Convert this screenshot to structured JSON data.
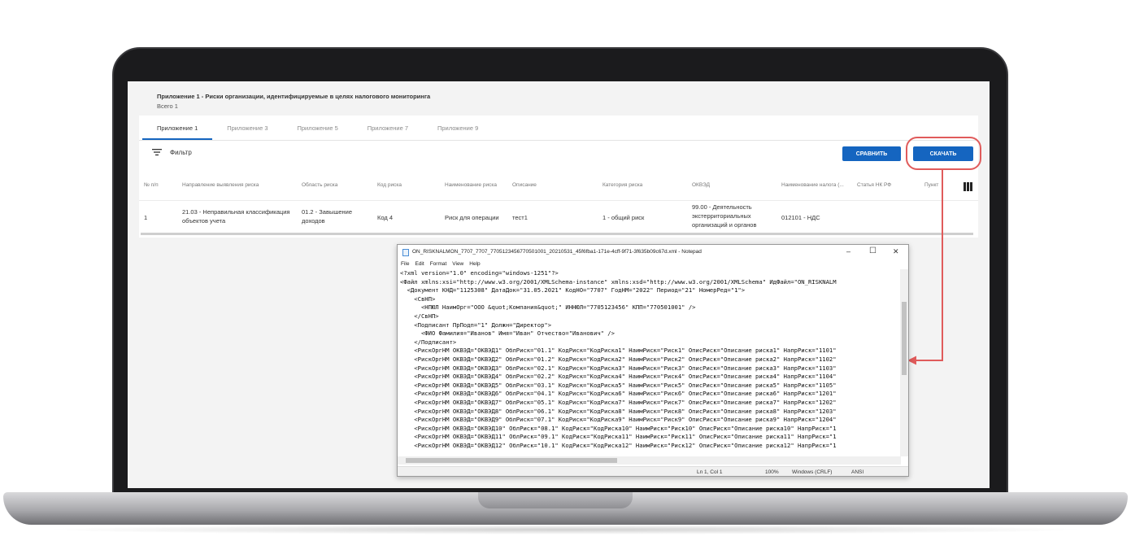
{
  "app": {
    "title": "Приложение 1 - Риски организации, идентифицируемые в целях налогового мониторинга",
    "total": "Всего 1",
    "tabs": [
      "Приложение 1",
      "Приложение 3",
      "Приложение 5",
      "Приложение 7",
      "Приложение 9"
    ],
    "filter_label": "Фильтр",
    "compare_label": "СРАВНИТЬ",
    "download_label": "СКАЧАТЬ",
    "columns": [
      "№ п/п",
      "Направление выявления риска",
      "Область риска",
      "Код риска",
      "Наименование риска",
      "Описание",
      "Категория риска",
      "ОКВЭД",
      "Наименование налога (...",
      "Статья НК РФ",
      "Пункт"
    ],
    "row": {
      "num": "1",
      "direction": "21.03 - Неправильная классификация объектов учета",
      "area": "01.2 - Завышение доходов",
      "code": "Код 4",
      "name": "Риск для операции",
      "description": "тест1",
      "category": "1 - общий риск",
      "okved": "99.00 - Деятельность экстерриториальных организаций и органов",
      "tax": "012101 - НДС"
    }
  },
  "notepad": {
    "title": "ON_RISKNALMON_7707_7707_7705123456770501001_20210531_45f6fba1-171e-4cff-9f71-3f635b09c67d.xml - Notepad",
    "menu": [
      "File",
      "Edit",
      "Format",
      "View",
      "Help"
    ],
    "lines": [
      "<?xml version=\"1.0\" encoding=\"windows-1251\"?>",
      "<Файл xmlns:xsi=\"http://www.w3.org/2001/XMLSchema-instance\" xmlns:xsd=\"http://www.w3.org/2001/XMLSchema\" ИдФайл=\"ON_RISKNALM",
      "  <Документ КНД=\"1125308\" ДатаДок=\"31.05.2021\" КодНО=\"7707\" ГодНМ=\"2022\" Период=\"21\" НомерРед=\"1\">",
      "    <СвНП>",
      "      <НПЮЛ НаимОрг=\"ООО &quot;Компания&quot;\" ИННЮЛ=\"7705123456\" КПП=\"770501001\" />",
      "    </СвНП>",
      "    <Подписант ПрПодп=\"1\" Должн=\"Директор\">",
      "      <ФИО Фамилия=\"Иванов\" Имя=\"Иван\" Отчество=\"Иванович\" />",
      "    </Подписант>",
      "    <РискОргНМ ОКВЭД=\"ОКВЭД1\" ОблРиск=\"01.1\" КодРиск=\"КодРиска1\" НаимРиск=\"Риск1\" ОписРиск=\"Описание риска1\" НапрРиск=\"1101\"",
      "    <РискОргНМ ОКВЭД=\"ОКВЭД2\" ОблРиск=\"01.2\" КодРиск=\"КодРиска2\" НаимРиск=\"Риск2\" ОписРиск=\"Описание риска2\" НапрРиск=\"1102\"",
      "    <РискОргНМ ОКВЭД=\"ОКВЭД3\" ОблРиск=\"02.1\" КодРиск=\"КодРиска3\" НаимРиск=\"Риск3\" ОписРиск=\"Описание риска3\" НапрРиск=\"1103\"",
      "    <РискОргНМ ОКВЭД=\"ОКВЭД4\" ОблРиск=\"02.2\" КодРиск=\"КодРиска4\" НаимРиск=\"Риск4\" ОписРиск=\"Описание риска4\" НапрРиск=\"1104\"",
      "    <РискОргНМ ОКВЭД=\"ОКВЭД5\" ОблРиск=\"03.1\" КодРиск=\"КодРиска5\" НаимРиск=\"Риск5\" ОписРиск=\"Описание риска5\" НапрРиск=\"1105\"",
      "    <РискОргНМ ОКВЭД=\"ОКВЭД6\" ОблРиск=\"04.1\" КодРиск=\"КодРиска6\" НаимРиск=\"Риск6\" ОписРиск=\"Описание риска6\" НапрРиск=\"1201\"",
      "    <РискОргНМ ОКВЭД=\"ОКВЭД7\" ОблРиск=\"05.1\" КодРиск=\"КодРиска7\" НаимРиск=\"Риск7\" ОписРиск=\"Описание риска7\" НапрРиск=\"1202\"",
      "    <РискОргНМ ОКВЭД=\"ОКВЭД8\" ОблРиск=\"06.1\" КодРиск=\"КодРиска8\" НаимРиск=\"Риск8\" ОписРиск=\"Описание риска8\" НапрРиск=\"1203\"",
      "    <РискОргНМ ОКВЭД=\"ОКВЭД9\" ОблРиск=\"07.1\" КодРиск=\"КодРиска9\" НаимРиск=\"Риск9\" ОписРиск=\"Описание риска9\" НапрРиск=\"1204\"",
      "    <РискОргНМ ОКВЭД=\"ОКВЭД10\" ОблРиск=\"08.1\" КодРиск=\"КодРиска10\" НаимРиск=\"Риск10\" ОписРиск=\"Описание риска10\" НапрРиск=\"1",
      "    <РискОргНМ ОКВЭД=\"ОКВЭД11\" ОблРиск=\"09.1\" КодРиск=\"КодРиска11\" НаимРиск=\"Риск11\" ОписРиск=\"Описание риска11\" НапрРиск=\"1",
      "    <РискОргНМ ОКВЭД=\"ОКВЭД12\" ОблРиск=\"10.1\" КодРиск=\"КодРиска12\" НаимРиск=\"Риск12\" ОписРиск=\"Описание риска12\" НапрРиск=\"1"
    ],
    "status": {
      "position": "Ln 1, Col 1",
      "zoom": "100%",
      "line_ending": "Windows (CRLF)",
      "encoding": "ANSI"
    }
  },
  "colors": {
    "accent": "#1565c0",
    "highlight": "#e05b5b"
  }
}
